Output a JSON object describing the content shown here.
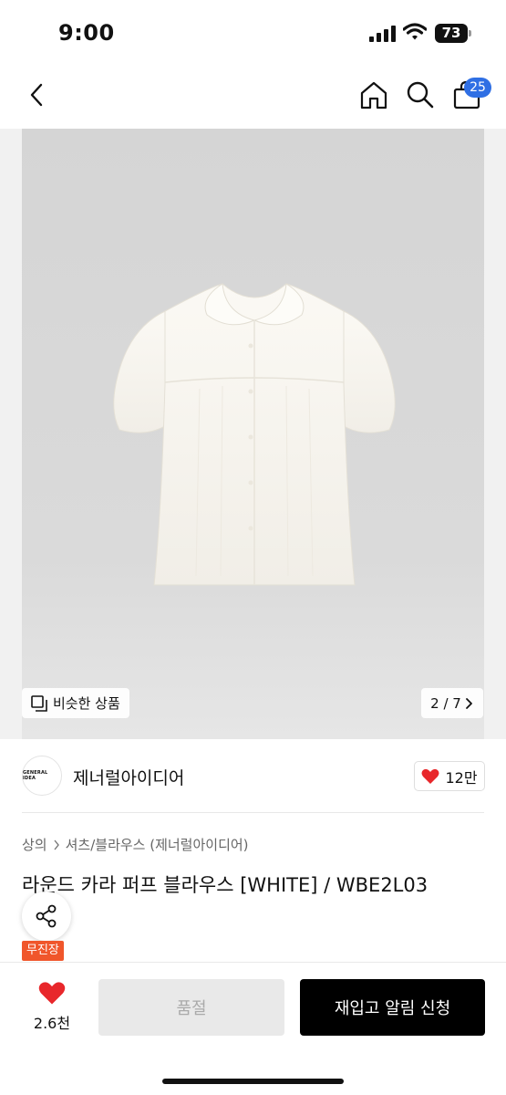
{
  "status_bar": {
    "time": "9:00",
    "battery": "73"
  },
  "nav": {
    "cart_count": "25"
  },
  "gallery": {
    "similar_label": "비슷한 상품",
    "page_indicator": "2 / 7"
  },
  "brand": {
    "logo_text": "GENERAL IDEA",
    "name": "제너럴아이디어",
    "likes": "12만"
  },
  "breadcrumb": {
    "level1": "상의",
    "level2": "셔츠/블라우스 (제너럴아이디어)"
  },
  "product": {
    "title": "라운드 카라 퍼프 블라우스 [WHITE] / WBE2L03",
    "tag": "무진장"
  },
  "bottom": {
    "wish_count": "2.6천",
    "soldout_label": "품절",
    "restock_label": "재입고 알림 신청"
  },
  "colors": {
    "accent_red": "#e8272b",
    "badge_blue": "#2f6fe4",
    "tag_orange": "#f0562b"
  }
}
